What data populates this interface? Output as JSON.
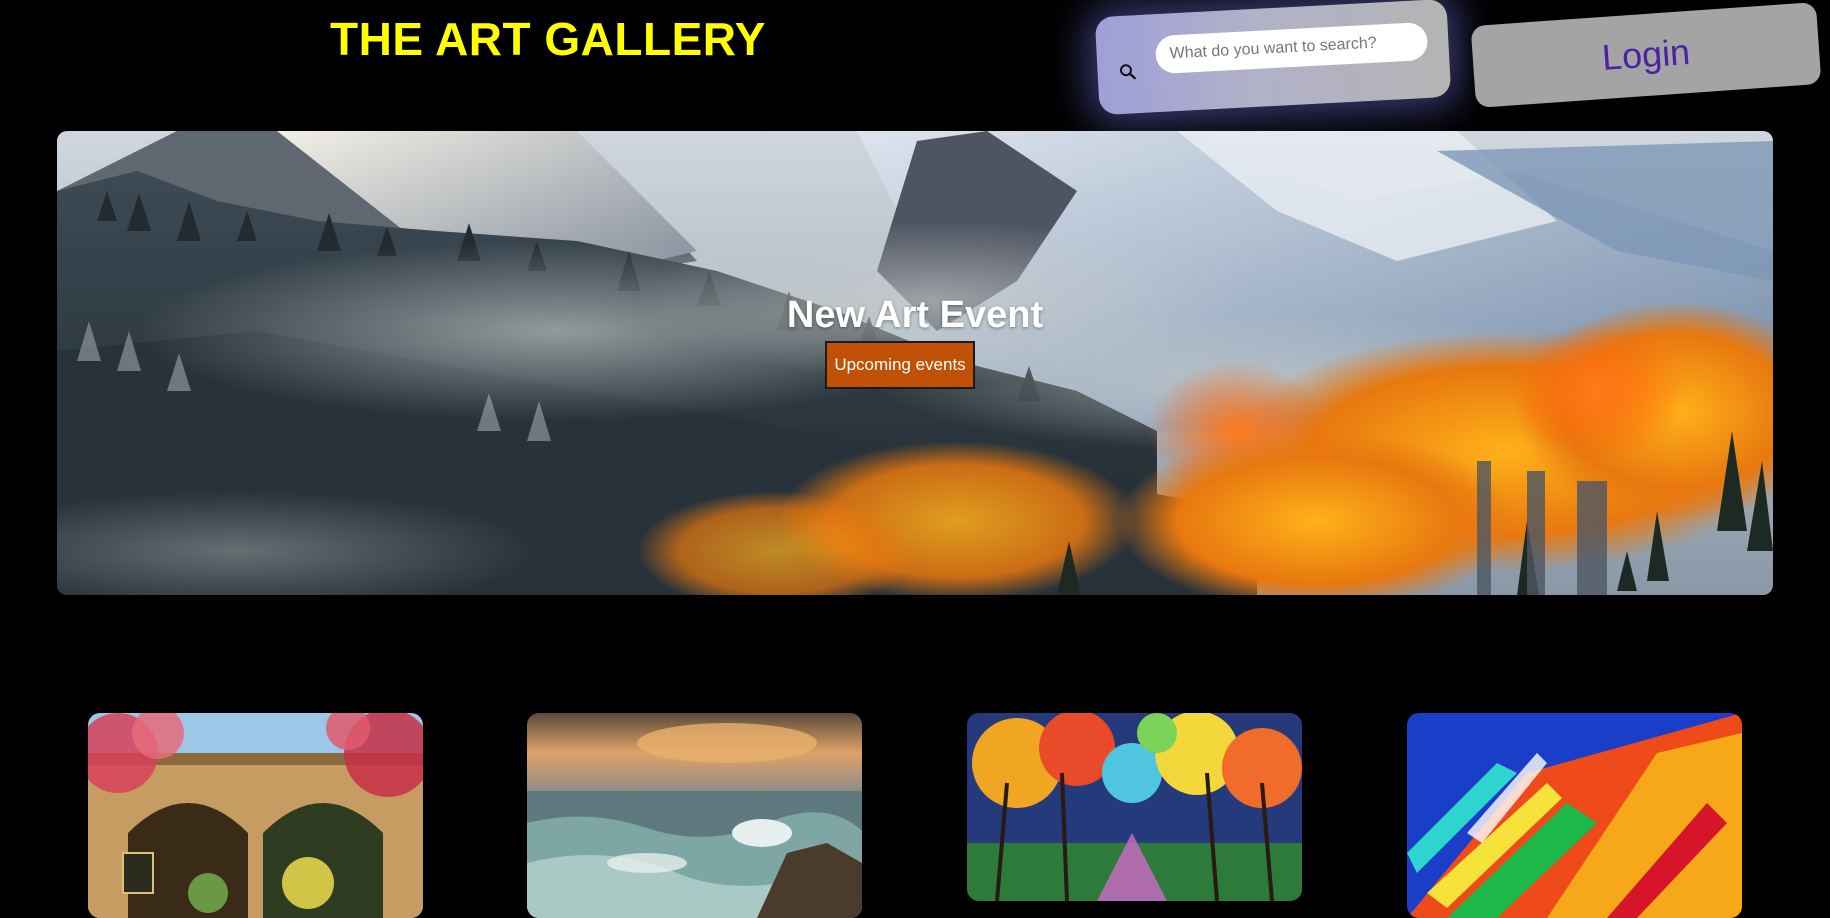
{
  "header": {
    "title": "THE ART GALLERY",
    "search_placeholder": "What do you want to search?",
    "login_label": "Login"
  },
  "hero": {
    "title": "New Art Event",
    "button_label": "Upcoming events"
  },
  "gallery": {
    "items": [
      {
        "subject": "garden arches with flowers"
      },
      {
        "subject": "seascape with waves"
      },
      {
        "subject": "colorful autumn trees"
      },
      {
        "subject": "abstract color streaks"
      }
    ]
  }
}
